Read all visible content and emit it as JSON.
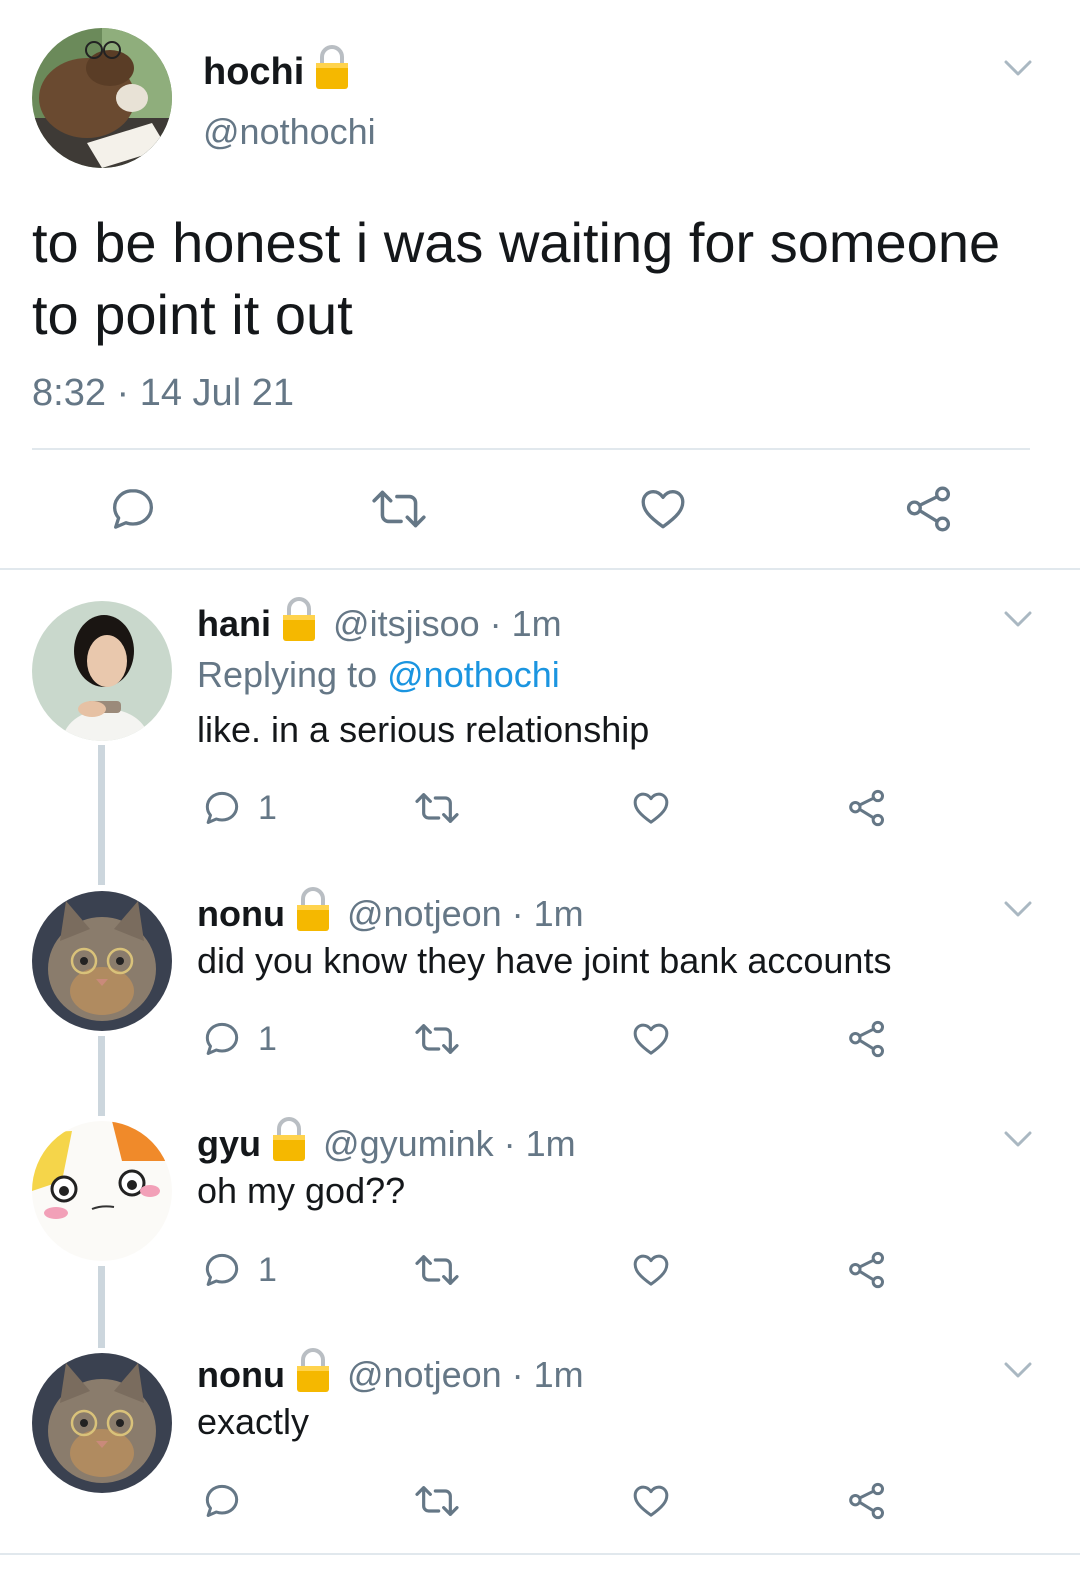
{
  "main_tweet": {
    "name": "hochi",
    "handle": "@nothochi",
    "text": "to be honest i was waiting for someone to point it out",
    "timestamp": "8:32 · 14 Jul 21"
  },
  "replies": [
    {
      "name": "hani",
      "handle": "@itsjisoo",
      "time": "· 1m",
      "replying_label": "Replying to",
      "replying_handle": "@nothochi",
      "text": "like. in a serious relationship",
      "reply_count": "1"
    },
    {
      "name": "nonu",
      "handle": "@notjeon",
      "time": "· 1m",
      "text": "did you know they have joint bank accounts",
      "reply_count": "1"
    },
    {
      "name": "gyu",
      "handle": "@gyumink",
      "time": "· 1m",
      "text": "oh my god??",
      "reply_count": "1"
    },
    {
      "name": "nonu",
      "handle": "@notjeon",
      "time": "· 1m",
      "text": "exactly",
      "reply_count": ""
    }
  ],
  "icons": {
    "reply": "reply-icon",
    "retweet": "retweet-icon",
    "like": "heart-icon",
    "share": "share-icon",
    "more": "chevron-down-icon",
    "protected": "lock-icon"
  },
  "colors": {
    "text": "#14171a",
    "secondary": "#657786",
    "link": "#1b95e0",
    "lock": "#f5b800",
    "divider": "#e1e8ed",
    "thread_line": "#ccd6dd"
  }
}
